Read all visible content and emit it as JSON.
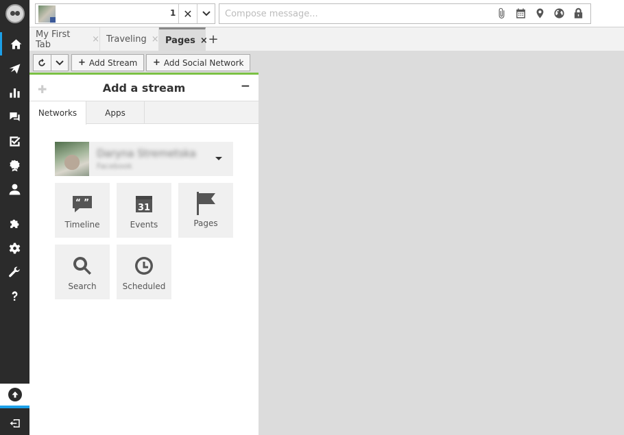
{
  "topbar": {
    "selected_count": "1",
    "compose_placeholder": "Compose message..."
  },
  "tabs": [
    {
      "label": "My First Tab",
      "close": "×"
    },
    {
      "label": "Traveling",
      "close": "×"
    },
    {
      "label": "Pages",
      "close": "×"
    }
  ],
  "add_tab_label": "+",
  "stream_toolbar": {
    "add_stream": "Add Stream",
    "add_social_network": "Add Social Network"
  },
  "panel": {
    "title": "Add a stream",
    "minimize": "−",
    "tabs": [
      "Networks",
      "Apps"
    ],
    "account": {
      "name": "Daryna Stremetska",
      "network": "Facebook"
    },
    "stream_types": [
      {
        "label": "Timeline",
        "icon": "timeline-icon"
      },
      {
        "label": "Events",
        "icon": "calendar-icon",
        "icon_text": "31"
      },
      {
        "label": "Pages",
        "icon": "flag-icon"
      },
      {
        "label": "Search",
        "icon": "search-icon"
      },
      {
        "label": "Scheduled",
        "icon": "clock-icon"
      }
    ]
  },
  "colors": {
    "sidebar": "#2b2b2b",
    "accent_blue": "#1ca0e8",
    "accent_green": "#7ac143"
  }
}
